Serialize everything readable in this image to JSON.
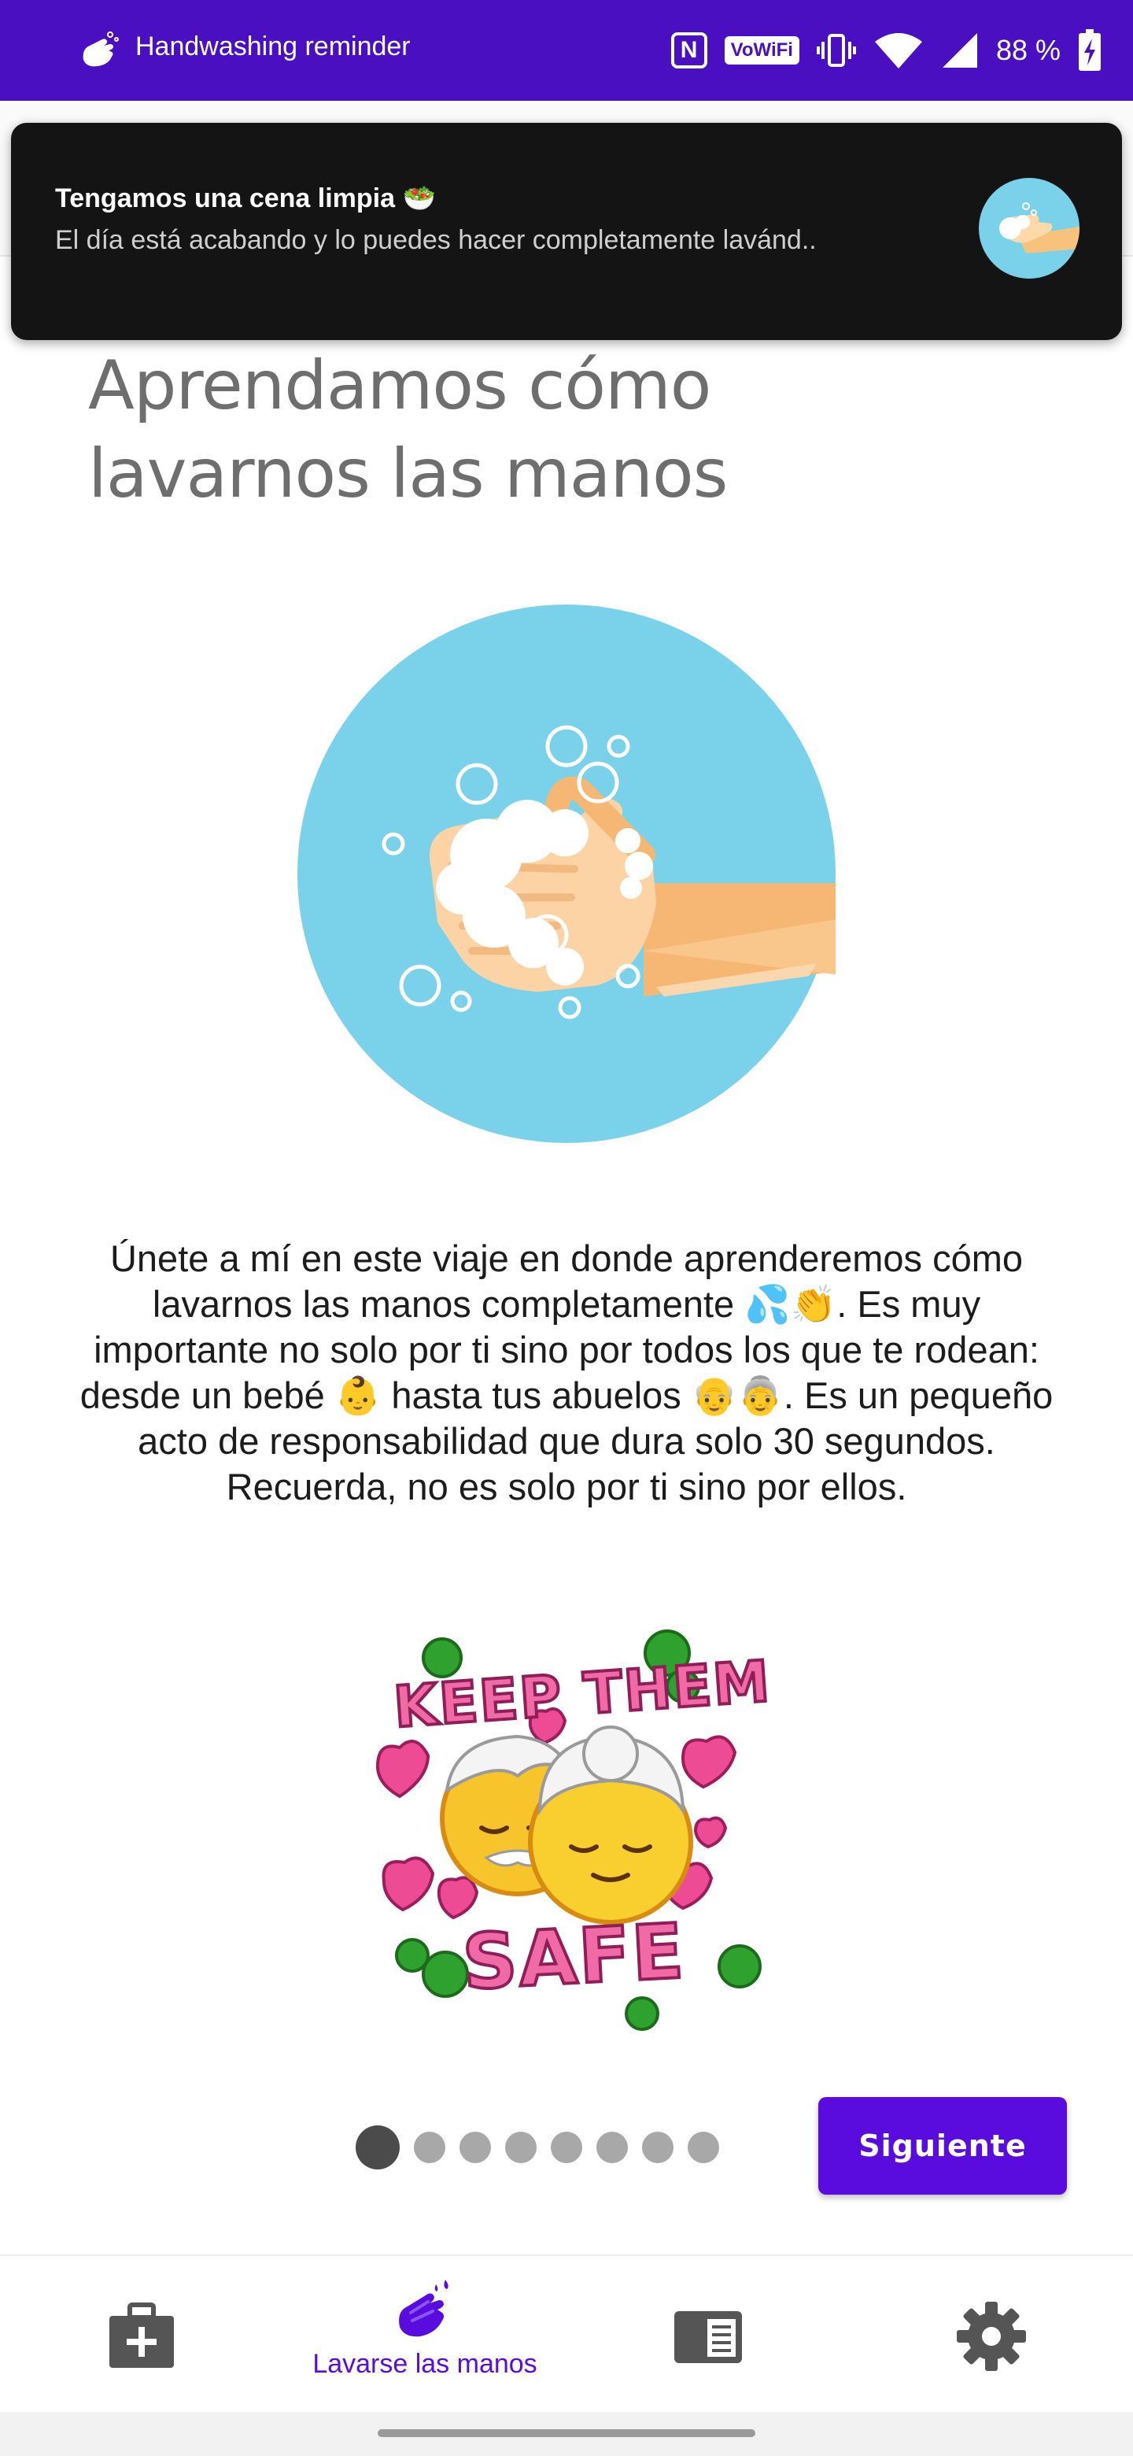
{
  "status_bar": {
    "app_name": "Handwashing reminder",
    "nfc": "N",
    "vowifi": "VoWiFi",
    "battery": "88 %"
  },
  "notification": {
    "title": "Tengamos una cena limpia 🥗",
    "body": "El día está acabando y lo puedes hacer completamente lavánd.."
  },
  "page": {
    "heading_line1": "Aprendamos cómo",
    "heading_line2": "lavarnos las manos",
    "description": "Únete a mí en este viaje en donde aprenderemos cómo lavarnos las manos completamente 💦👏. Es muy importante no solo por ti sino por todos los que te rodean: desde un bebé 👶 hasta tus abuelos 👴👵. Es un pequeño acto de responsabilidad que dura solo 30 segundos. Recuerda, no es solo por ti sino por ellos.",
    "sticker_top": "KEEP THEM",
    "sticker_bottom": "SAFE"
  },
  "pager": {
    "total": 8,
    "current": 1
  },
  "actions": {
    "next_label": "Siguiente"
  },
  "bottom_nav": {
    "items": [
      {
        "icon": "first-aid-kit-icon",
        "label": ""
      },
      {
        "icon": "washing-hands-icon",
        "label": "Lavarse las manos"
      },
      {
        "icon": "news-icon",
        "label": ""
      },
      {
        "icon": "gear-icon",
        "label": ""
      }
    ],
    "active_index": 1
  },
  "colors": {
    "status_bar": "#4a0fc0",
    "accent": "#5a0cde",
    "hero_circle": "#79d1ea",
    "heading_text": "#6e6e6e",
    "toast_bg": "#141414"
  }
}
